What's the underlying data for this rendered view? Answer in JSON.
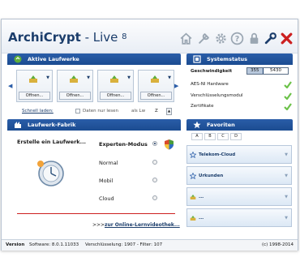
{
  "app": {
    "brand": "ArchiCrypt",
    "suffix": " - Live ",
    "version": "8"
  },
  "toolbar": [
    "home-icon",
    "tools-icon",
    "settings-gear-icon",
    "help-icon",
    "lock-icon",
    "wrench-icon",
    "close-icon"
  ],
  "drives": {
    "header": "Aktive Laufwerke",
    "slots": [
      {
        "button": "Offnen..."
      },
      {
        "button": "Offnen..."
      },
      {
        "button": "Offnen..."
      },
      {
        "button": "Offnen..."
      }
    ],
    "quick_load_label": "Schnell laden:",
    "read_only_label": "Daten nur lesen",
    "as_label": "als Lw",
    "drive_letter": "Z"
  },
  "factory": {
    "header": "Laufwerk-Fabrik",
    "create_label": "Erstelle ein Laufwerk...",
    "options": [
      {
        "label": "Experten-Modus",
        "selected": true
      },
      {
        "label": "Normal",
        "selected": false
      },
      {
        "label": "Mobil",
        "selected": false
      },
      {
        "label": "Cloud",
        "selected": false
      }
    ],
    "tutorial_prefix": ">>>",
    "tutorial_link": "zur Online-Lernvideothek..."
  },
  "status": {
    "header": "Systemstatus",
    "speed_label": "Geschwindigkeit",
    "speed_value": "355",
    "speed_max": "5430",
    "rows": [
      {
        "label": "AES-NI Hardware"
      },
      {
        "label": "Verschlüsselungsmodul"
      },
      {
        "label": "Zertifikate"
      }
    ],
    "check_color": "#6cc24a"
  },
  "favorites": {
    "header": "Favoriten",
    "tabs": [
      "A",
      "B",
      "C",
      "D"
    ],
    "items": [
      {
        "label": "Telekom-Cloud",
        "icon": "star-icon"
      },
      {
        "label": "Urkunden",
        "icon": "star-icon"
      },
      {
        "label": "...",
        "icon": "drive-icon"
      },
      {
        "label": "...",
        "icon": "drive-icon"
      }
    ]
  },
  "footer": {
    "version_label": "Version",
    "software": "Software: 8.0.1.11033",
    "encryption": "Verschlüsselung: 1907 - Filter: 107",
    "copyright": "(c) 1998-2014"
  },
  "colors": {
    "header_blue": "#1f4f96",
    "brand_blue": "#1b3d6b",
    "accent_red": "#cc2020"
  }
}
